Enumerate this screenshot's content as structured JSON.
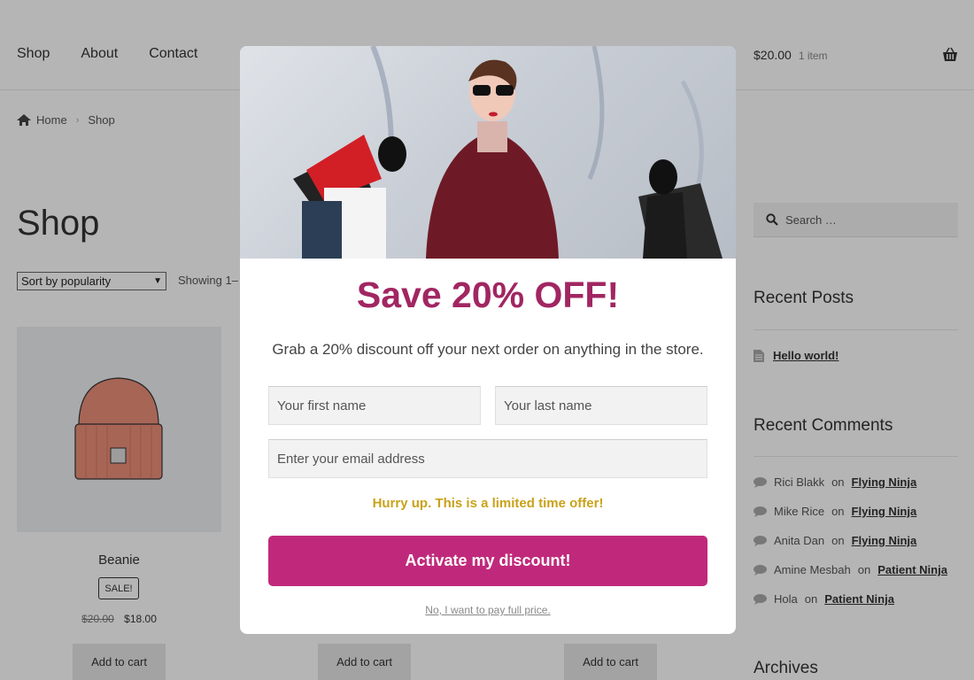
{
  "header": {
    "nav": [
      "Shop",
      "About",
      "Contact"
    ],
    "cart_total": "$20.00",
    "cart_count": "1 item"
  },
  "breadcrumb": {
    "home": "Home",
    "current": "Shop"
  },
  "main": {
    "title": "Shop",
    "sort_selected": "Sort by popularity",
    "showing_text": "Showing 1–",
    "product": {
      "name": "Beanie",
      "badge": "SALE!",
      "old_price": "$20.00",
      "price": "$18.00"
    },
    "add_to_cart": "Add to cart"
  },
  "sidebar": {
    "search_placeholder": "Search …",
    "recent_posts_title": "Recent Posts",
    "posts": [
      "Hello world!"
    ],
    "recent_comments_title": "Recent Comments",
    "comments": [
      {
        "author": "Rici Blakk",
        "on": "on",
        "post": "Flying Ninja"
      },
      {
        "author": "Mike Rice",
        "on": "on",
        "post": "Flying Ninja"
      },
      {
        "author": "Anita Dan",
        "on": "on",
        "post": "Flying Ninja"
      },
      {
        "author": "Amine Mesbah",
        "on": "on",
        "post": "Patient Ninja"
      },
      {
        "author": "Hola",
        "on": "on",
        "post": "Patient Ninja"
      }
    ],
    "archives_title": "Archives"
  },
  "modal": {
    "title": "Save 20% OFF!",
    "subtitle": "Grab a 20% discount off your next order on anything in the store.",
    "first_name_placeholder": "Your first name",
    "last_name_placeholder": "Your last name",
    "email_placeholder": "Enter your email address",
    "hurry_text": "Hurry up. This is a limited time offer!",
    "cta_label": "Activate my discount!",
    "decline_label": "No, I want to pay full price.",
    "colors": {
      "title": "#a12662",
      "cta": "#c0297b",
      "hurry": "#c9a21a"
    }
  }
}
